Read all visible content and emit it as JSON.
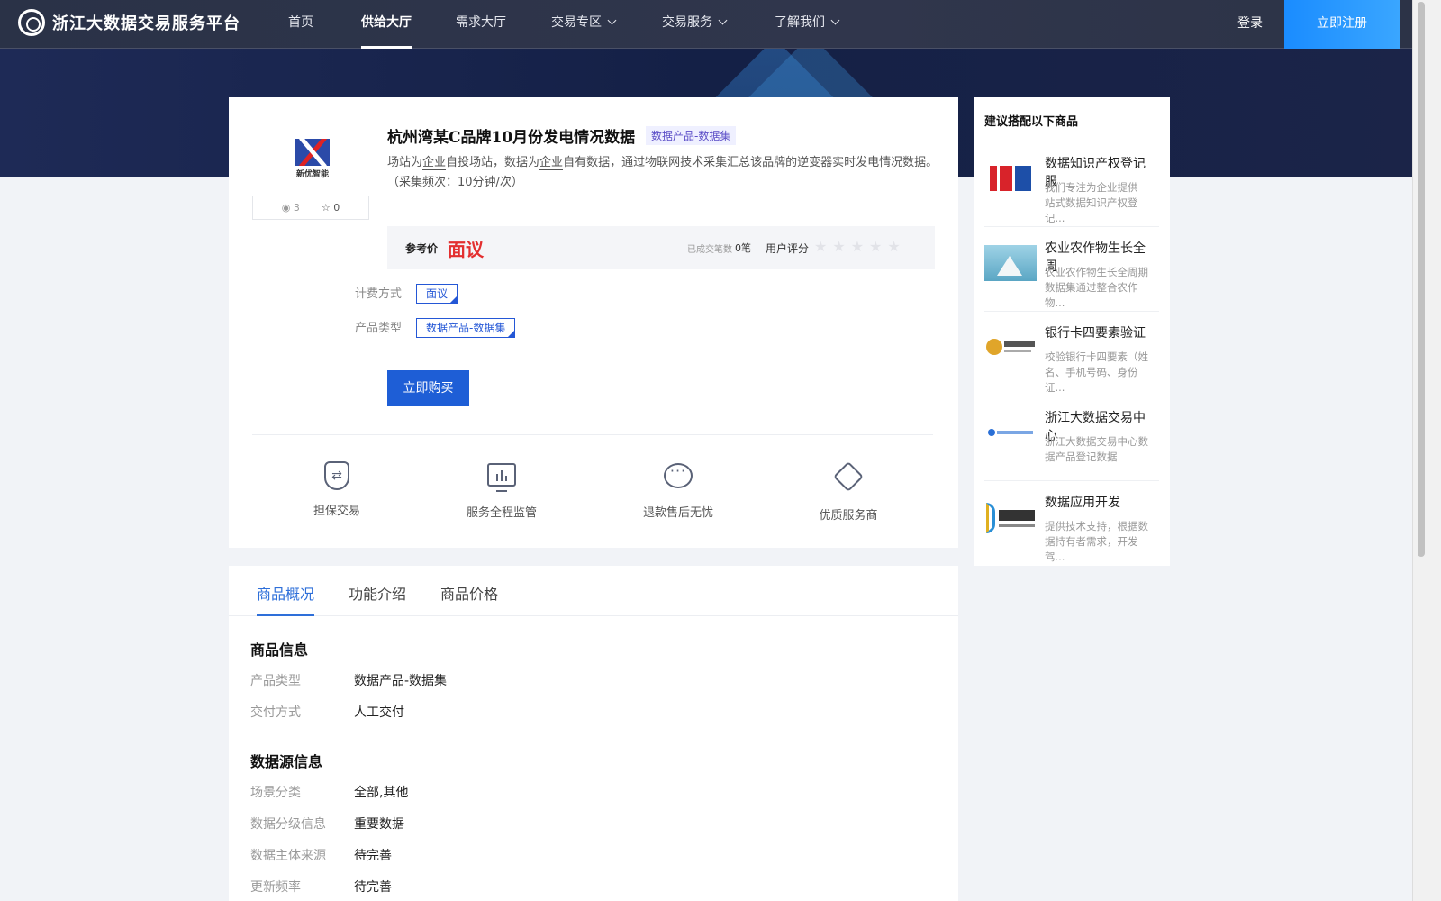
{
  "nav": {
    "brand": "浙江大数据交易服务平台",
    "items": [
      {
        "label": "首页"
      },
      {
        "label": "供给大厅"
      },
      {
        "label": "需求大厅"
      },
      {
        "label": "交易专区"
      },
      {
        "label": "交易服务"
      },
      {
        "label": "了解我们"
      }
    ],
    "login": "登录",
    "register": "立即注册"
  },
  "product": {
    "logo_caption": "新优智能",
    "views": "3",
    "favorites": "0",
    "title": "杭州湾某C品牌10月份发电情况数据",
    "category_tag": "数据产品-数据集",
    "desc_1": "场站为",
    "desc_2": "企业",
    "desc_3": "自投场站，数据为",
    "desc_4": "企业",
    "desc_5": "自有数据，通过物联网技术采集汇总该品牌的逆变器实时发电情况数据。（采集频次：10分钟/次）",
    "price_label": "参考价",
    "price_value": "面议",
    "deals_label": "已成交笔数",
    "deals_value": "0笔",
    "rating_label": "用户评分",
    "rating_value": 0,
    "billing_label": "计费方式",
    "billing_value": "面议",
    "type_label": "产品类型",
    "type_value": "数据产品-数据集",
    "buy_button": "立即购买"
  },
  "features": [
    {
      "label": "担保交易",
      "icon": "shield-exchange-icon"
    },
    {
      "label": "服务全程监管",
      "icon": "monitor-chart-icon"
    },
    {
      "label": "退款售后无忧",
      "icon": "chat-bubble-icon"
    },
    {
      "label": "优质服务商",
      "icon": "diamond-icon"
    }
  ],
  "sidebar": {
    "title": "建议搭配以下商品",
    "items": [
      {
        "name": "数据知识产权登记服",
        "desc": "我们专注为企业提供一站式数据知识产权登记..."
      },
      {
        "name": "农业农作物生长全周",
        "desc": "农业农作物生长全周期数据集通过整合农作物..."
      },
      {
        "name": "银行卡四要素验证",
        "desc": "校验银行卡四要素（姓名、手机号码、身份证..."
      },
      {
        "name": "浙江大数据交易中心",
        "desc": "浙江大数据交易中心数据产品登记数据"
      },
      {
        "name": "数据应用开发",
        "desc": "提供技术支持，根据数据持有者需求，开发驾..."
      }
    ]
  },
  "tabs": [
    {
      "label": "商品概况"
    },
    {
      "label": "功能介绍"
    },
    {
      "label": "商品价格"
    }
  ],
  "info": {
    "section1_title": "商品信息",
    "section1": [
      {
        "key": "产品类型",
        "value": "数据产品-数据集"
      },
      {
        "key": "交付方式",
        "value": "人工交付"
      }
    ],
    "section2_title": "数据源信息",
    "section2": [
      {
        "key": "场景分类",
        "value": "全部,其他"
      },
      {
        "key": "数据分级信息",
        "value": "重要数据"
      },
      {
        "key": "数据主体来源",
        "value": "待完善"
      },
      {
        "key": "更新频率",
        "value": "待完善"
      }
    ]
  },
  "colors": {
    "accent": "#1e5ed6",
    "price": "#e32f2f",
    "nav_bg": "#2a3247",
    "tag_bg": "#eff0ff"
  }
}
